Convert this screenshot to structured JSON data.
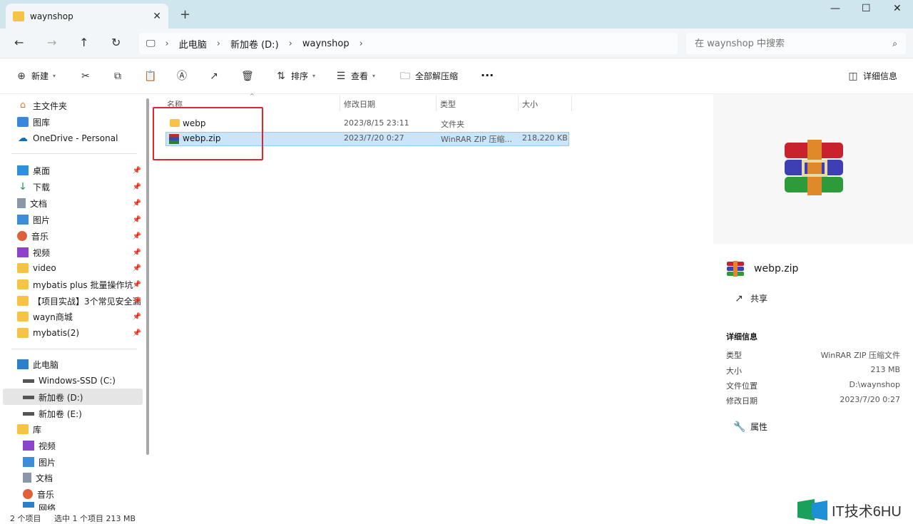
{
  "window": {
    "tab_title": "waynshop"
  },
  "nav": {
    "breadcrumb": [
      "此电脑",
      "新加卷 (D:)",
      "waynshop"
    ],
    "search_placeholder": "在 waynshop 中搜索"
  },
  "toolbar": {
    "new_label": "新建",
    "sort_label": "排序",
    "view_label": "查看",
    "extract_label": "全部解压缩",
    "more_label": "···",
    "details_label": "详细信息"
  },
  "sidebar": {
    "top": [
      {
        "label": "主文件夹",
        "icon": "home-icon"
      },
      {
        "label": "图库",
        "icon": "gallery-icon"
      },
      {
        "label": "OneDrive - Personal",
        "icon": "cloud-icon"
      }
    ],
    "pinned": [
      {
        "label": "桌面",
        "icon": "desktop-icon"
      },
      {
        "label": "下载",
        "icon": "download-icon"
      },
      {
        "label": "文档",
        "icon": "document-icon"
      },
      {
        "label": "图片",
        "icon": "picture-icon"
      },
      {
        "label": "音乐",
        "icon": "music-icon"
      },
      {
        "label": "视频",
        "icon": "video-icon"
      },
      {
        "label": "video",
        "icon": "folder-icon"
      },
      {
        "label": "mybatis plus 批量操作坑",
        "icon": "folder-icon"
      },
      {
        "label": "【项目实战】3个常见安全漏",
        "icon": "folder-icon"
      },
      {
        "label": "wayn商城",
        "icon": "folder-icon"
      },
      {
        "label": "mybatis(2)",
        "icon": "folder-icon"
      }
    ],
    "pc": {
      "label": "此电脑"
    },
    "drives": [
      {
        "label": "Windows-SSD (C:)"
      },
      {
        "label": "新加卷 (D:)"
      },
      {
        "label": "新加卷 (E:)"
      }
    ],
    "lib": {
      "label": "库"
    },
    "lib_items": [
      {
        "label": "视频"
      },
      {
        "label": "图片"
      },
      {
        "label": "文档"
      },
      {
        "label": "音乐"
      },
      {
        "label": "网络"
      }
    ]
  },
  "filelist": {
    "columns": [
      "名称",
      "修改日期",
      "类型",
      "大小"
    ],
    "rows": [
      {
        "name": "webp",
        "date": "2023/8/15 23:11",
        "type": "文件夹",
        "size": ""
      },
      {
        "name": "webp.zip",
        "date": "2023/7/20 0:27",
        "type": "WinRAR ZIP 压缩...",
        "size": "218,220 KB"
      }
    ]
  },
  "details": {
    "filename": "webp.zip",
    "share_label": "共享",
    "section_title": "详细信息",
    "props": [
      {
        "label": "类型",
        "value": "WinRAR ZIP 压缩文件"
      },
      {
        "label": "大小",
        "value": "213 MB"
      },
      {
        "label": "文件位置",
        "value": "D:\\waynshop"
      },
      {
        "label": "修改日期",
        "value": "2023/7/20 0:27"
      }
    ],
    "properties_label": "属性"
  },
  "status": {
    "count": "2 个项目",
    "selected": "选中 1 个项目  213 MB"
  },
  "watermark": {
    "text": "IT技术6HU"
  },
  "colors": {
    "accent": "#0067c0",
    "selection": "#cce4f7",
    "highlight_box": "#e0262b",
    "folder": "#f6c445"
  }
}
